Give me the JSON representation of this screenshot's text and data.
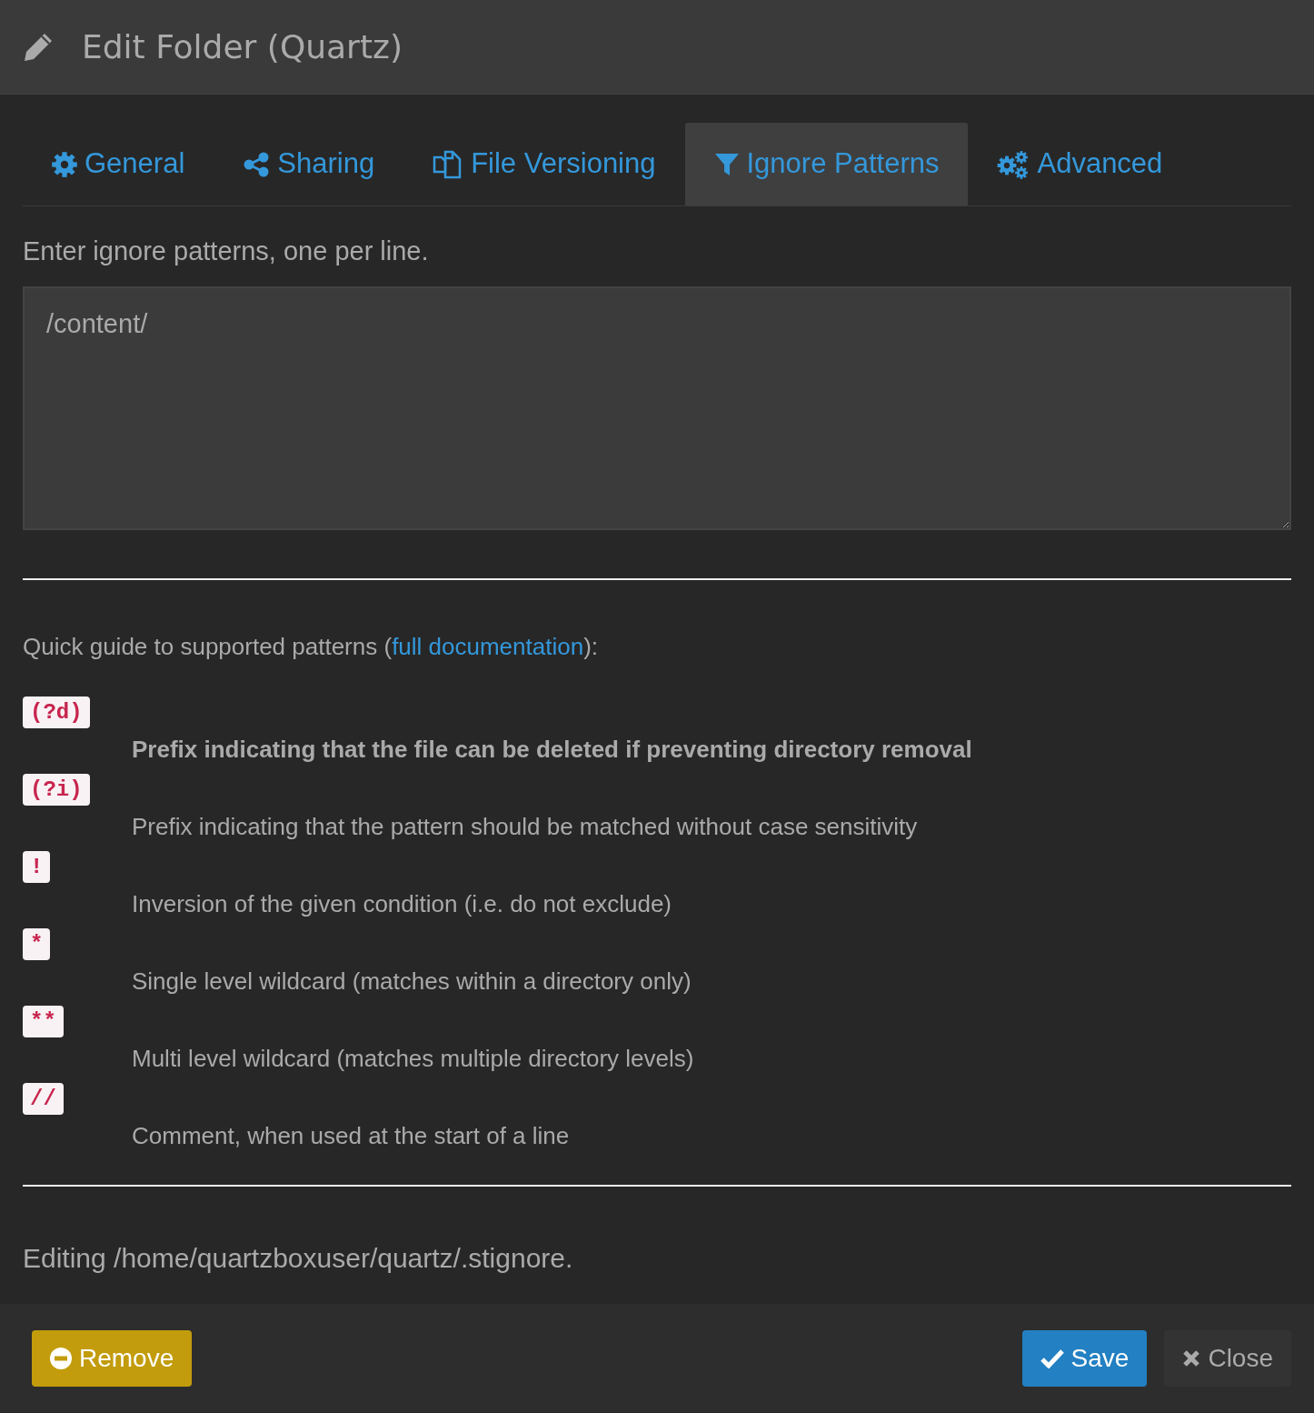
{
  "window": {
    "title": "Edit Folder (Quartz)"
  },
  "tabs": [
    {
      "label": "General",
      "kind": "gear",
      "selected": false
    },
    {
      "label": "Sharing",
      "kind": "share",
      "selected": false
    },
    {
      "label": "File Versioning",
      "kind": "copies",
      "selected": false
    },
    {
      "label": "Ignore Patterns",
      "kind": "filter",
      "selected": true
    },
    {
      "label": "Advanced",
      "kind": "gears",
      "selected": false
    }
  ],
  "intro": "Enter ignore patterns, one per line.",
  "patterns": {
    "value": "/content/"
  },
  "guide": {
    "before": "Quick guide to supported patterns (",
    "link": "full documentation",
    "after": "):"
  },
  "guide_items": [
    {
      "code": "(?d)",
      "description": "Prefix indicating that the file can be deleted if preventing directory removal",
      "bold": true
    },
    {
      "code": "(?i)",
      "description": "Prefix indicating that the pattern should be matched without case sensitivity",
      "bold": false
    },
    {
      "code": "!",
      "description": "Inversion of the given condition (i.e. do not exclude)",
      "bold": false
    },
    {
      "code": "*",
      "description": "Single level wildcard (matches within a directory only)",
      "bold": false
    },
    {
      "code": "**",
      "description": "Multi level wildcard (matches multiple directory levels)",
      "bold": false
    },
    {
      "code": "//",
      "description": "Comment, when used at the start of a line",
      "bold": false
    }
  ],
  "editing_note": "Editing /home/quartzboxuser/quartz/.stignore.",
  "buttons": [
    {
      "label": "Remove",
      "kind": "remove"
    },
    {
      "label": "Save",
      "kind": "save"
    },
    {
      "label": "Close",
      "kind": "close"
    }
  ]
}
